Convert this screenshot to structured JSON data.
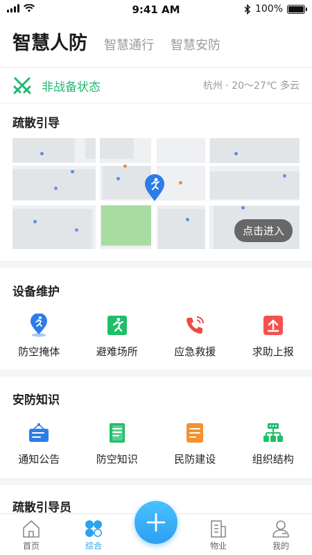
{
  "status_bar": {
    "time": "9:41 AM",
    "battery": "100%"
  },
  "header": {
    "active_tab": "智慧人防",
    "tabs": [
      "智慧通行",
      "智慧安防"
    ]
  },
  "readiness": {
    "status": "非战备状态",
    "weather": "杭州 · 20～27℃ 多云",
    "accent_color": "#21b76f"
  },
  "evacuation": {
    "title": "疏散引导",
    "enter_label": "点击进入"
  },
  "equipment": {
    "title": "设备维护",
    "items": [
      {
        "label": "防空掩体",
        "icon": "runner-pin-icon"
      },
      {
        "label": "避难场所",
        "icon": "exit-runner-icon"
      },
      {
        "label": "应急救援",
        "icon": "phone-icon"
      },
      {
        "label": "求助上报",
        "icon": "upload-icon"
      }
    ]
  },
  "knowledge": {
    "title": "安防知识",
    "items": [
      {
        "label": "通知公告",
        "icon": "notice-board-icon"
      },
      {
        "label": "防空知识",
        "icon": "book-icon"
      },
      {
        "label": "民防建设",
        "icon": "document-icon"
      },
      {
        "label": "组织结构",
        "icon": "org-chart-icon"
      }
    ]
  },
  "guides": {
    "title": "疏散引导员"
  },
  "bottom_nav": {
    "items": [
      {
        "label": "首页",
        "icon": "home-icon"
      },
      {
        "label": "综合",
        "icon": "grid-circles-icon",
        "active": true
      },
      {
        "label": "物业",
        "icon": "building-icon"
      },
      {
        "label": "我的",
        "icon": "user-icon"
      }
    ],
    "active_color": "#2aa3ea"
  }
}
